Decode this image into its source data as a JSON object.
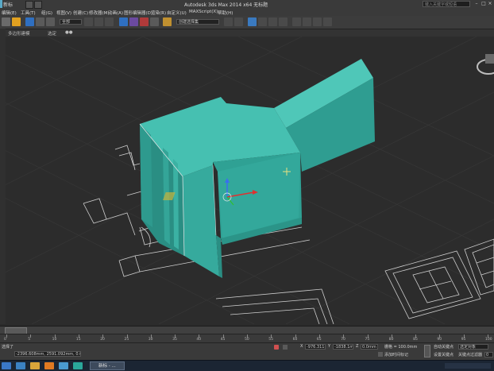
{
  "window": {
    "project_name": "新标",
    "title": "Autodesk 3ds Max  2014 x64    无标题",
    "search_placeholder": "键入关键字或短语"
  },
  "menu": {
    "items": [
      "编辑(E)",
      "工具(T)",
      "组(G)",
      "视图(V)",
      "创建(C)",
      "修改器(M)",
      "动画(A)",
      "图形编辑器(D)",
      "渲染(R)",
      "自定义(U)",
      "MAXScript(X)",
      "帮助(H)"
    ]
  },
  "toolbar": {
    "filter_label": "全部",
    "selection_set_label": "创建选择集"
  },
  "ribbon": {
    "items": [
      "多边形建模",
      "选定",
      "●●"
    ]
  },
  "timeline": {
    "ticks": [
      "0",
      "5",
      "10",
      "15",
      "20",
      "25",
      "30",
      "35",
      "40",
      "45",
      "50",
      "55",
      "60",
      "65",
      "70",
      "75",
      "80",
      "85",
      "90",
      "95",
      "100"
    ]
  },
  "status": {
    "selection_text": "选择了",
    "coords_text": "-2396.608mm, 2591.092mm, 0.0mm",
    "x_label": "X",
    "x_value": "-976.311mm",
    "y_label": "Y",
    "y_value": "-1838.1mm",
    "z_label": "Z",
    "z_value": "0.0mm",
    "grid_label": "栅格 = 100.0mm",
    "auto_key_label": "自动关键点",
    "selected_dropdown": "选定对象",
    "set_key_label": "设置关键点",
    "key_filters_label": "关键点过滤器",
    "add_time_tag": "添加时间标记",
    "frame_value": "0"
  },
  "taskbar": {
    "active_task_label": "新标 - ..."
  },
  "colors": {
    "model": "#3fb5a7",
    "model_dark": "#2e9a8e",
    "viewport_bg": "#2c2c2c",
    "grid_lines": "#3a3a3a",
    "floorplan": "#d8d8d8"
  }
}
